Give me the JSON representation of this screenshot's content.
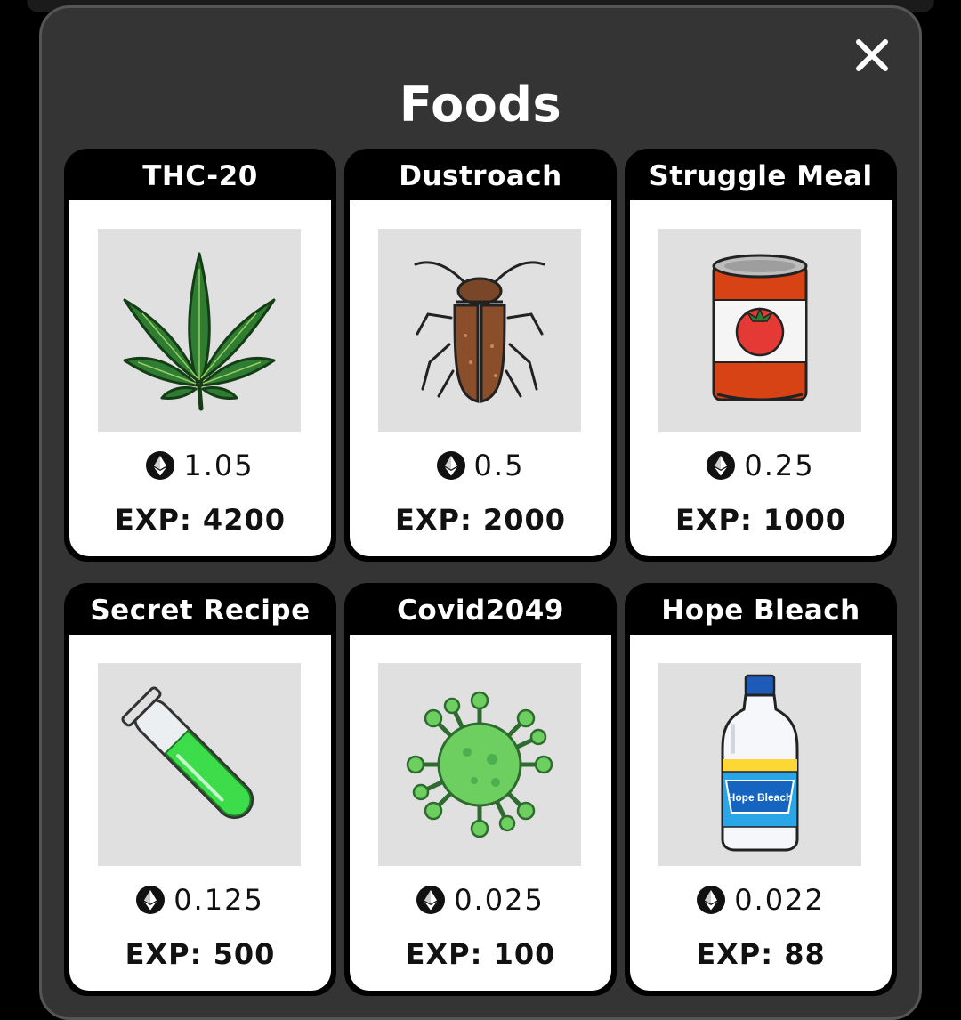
{
  "modal": {
    "title": "Foods",
    "close_icon": "close-icon"
  },
  "currency_icon": "ethereum-icon",
  "items": [
    {
      "name": "THC-20",
      "price": "1.05",
      "exp": "EXP: 4200",
      "icon": "cannabis-leaf-icon"
    },
    {
      "name": "Dustroach",
      "price": "0.5",
      "exp": "EXP: 2000",
      "icon": "cockroach-icon"
    },
    {
      "name": "Struggle Meal",
      "price": "0.25",
      "exp": "EXP: 1000",
      "icon": "tomato-can-icon"
    },
    {
      "name": "Secret Recipe",
      "price": "0.125",
      "exp": "EXP: 500",
      "icon": "test-tube-icon"
    },
    {
      "name": "Covid2049",
      "price": "0.025",
      "exp": "EXP: 100",
      "icon": "virus-icon"
    },
    {
      "name": "Hope Bleach",
      "price": "0.022",
      "exp": "EXP: 88",
      "icon": "bleach-bottle-icon",
      "label_text": "Hope Bleach"
    }
  ]
}
